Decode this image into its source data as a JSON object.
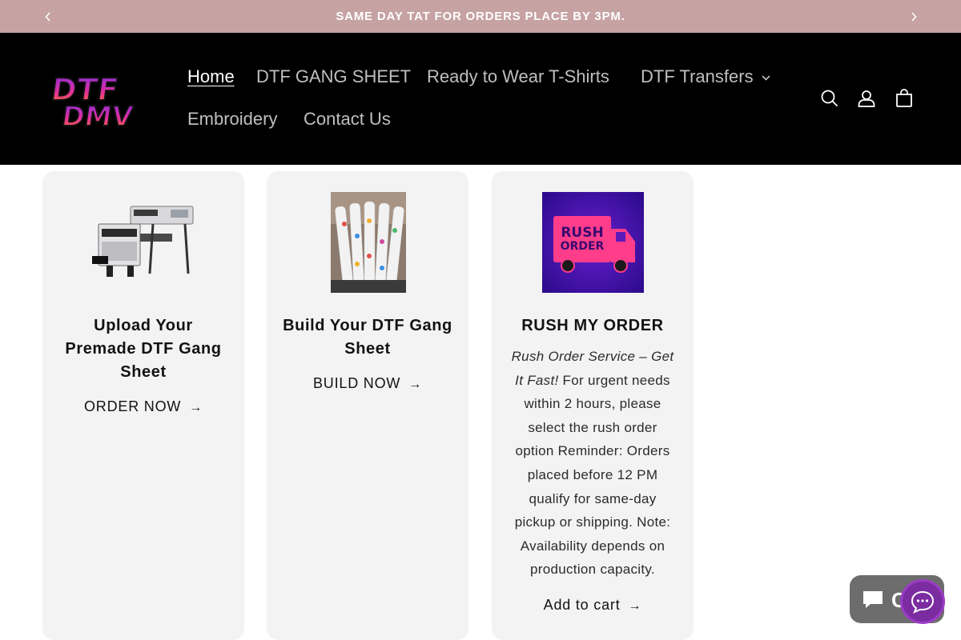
{
  "announcement": {
    "text": "SAME DAY TAT FOR ORDERS PLACE BY 3PM.",
    "prev_icon": "chevron-left-icon",
    "next_icon": "chevron-right-icon"
  },
  "header": {
    "logo_alt": "DTF DMV",
    "nav": [
      {
        "label": "Home",
        "active": true
      },
      {
        "label": "DTF GANG SHEET"
      },
      {
        "label": "Ready to Wear T-Shirts"
      },
      {
        "label": "DTF Transfers",
        "has_dropdown": true
      },
      {
        "label": "Embroidery"
      },
      {
        "label": "Contact Us"
      }
    ],
    "icons": [
      "search-icon",
      "account-icon",
      "cart-icon"
    ]
  },
  "cards": [
    {
      "title": "Upload Your Premade DTF Gang Sheet",
      "link": "ORDER NOW",
      "image": "dtf-printer-image"
    },
    {
      "title": "Build Your DTF Gang Sheet",
      "link": "BUILD NOW",
      "image": "transfer-rolls-image"
    },
    {
      "title": "RUSH MY ORDER",
      "desc_italic": "Rush Order Service – Get It Fast!",
      "desc_rest": " For urgent needs within 2 hours, please select the rush order option Reminder: Orders placed before 12 PM qualify for same-day pickup or shipping. Note: Availability depends on production capacity.",
      "link": "Add to cart",
      "image": "rush-order-truck-image",
      "image_text": [
        "RUSH",
        "ORDER"
      ]
    }
  ],
  "chat": {
    "pill_label": "Chat"
  },
  "colors": {
    "announcement_bg": "#c6a2a2",
    "header_bg": "#000000",
    "card_bg": "#f3f3f3",
    "chat_purple": "#7b2ca1"
  }
}
